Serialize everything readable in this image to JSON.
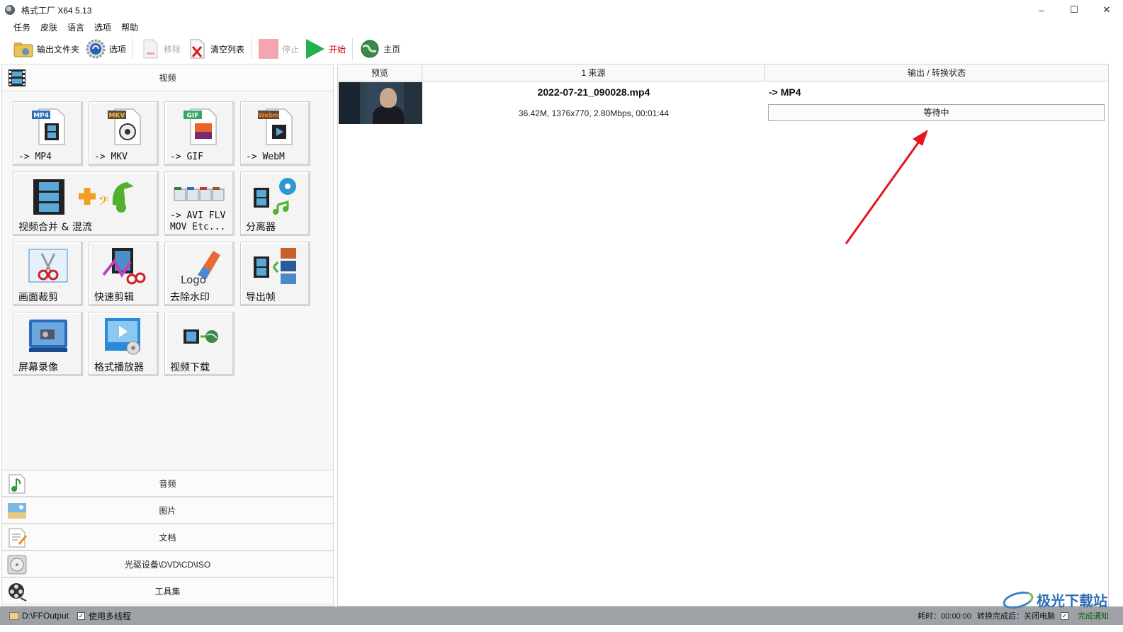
{
  "window": {
    "title": "格式工厂 X64 5.13",
    "controls": {
      "minimize": "–",
      "maximize": "☐",
      "close": "✕"
    }
  },
  "menu": [
    "任务",
    "皮肤",
    "语言",
    "选项",
    "帮助"
  ],
  "toolbar": {
    "output_folder": "输出文件夹",
    "options": "选项",
    "remove": "移除",
    "clear_list": "清空列表",
    "stop": "停止",
    "start": "开始",
    "home": "主页"
  },
  "left_panel": {
    "video_category": "视频",
    "tiles": [
      {
        "label": "-> MP4",
        "badge": "MP4"
      },
      {
        "label": "-> MKV",
        "badge": "MKV"
      },
      {
        "label": "-> GIF",
        "badge": "GIF"
      },
      {
        "label": "-> WebM",
        "badge": "Webm"
      },
      {
        "label": "视频合并 & 混流"
      },
      {
        "label": "-> AVI FLV\nMOV Etc..."
      },
      {
        "label": "分离器"
      },
      {
        "label": "画面裁剪"
      },
      {
        "label": "快速剪辑"
      },
      {
        "label": "去除水印",
        "badge": "Logo"
      },
      {
        "label": "导出帧"
      },
      {
        "label": "屏幕录像"
      },
      {
        "label": "格式播放器"
      },
      {
        "label": "视频下载"
      }
    ],
    "bottom_categories": [
      "音频",
      "图片",
      "文档",
      "光驱设备\\DVD\\CD\\ISO",
      "工具集"
    ]
  },
  "task_table": {
    "headers": [
      "预览",
      "1 来源",
      "输出 / 转换状态"
    ],
    "rows": [
      {
        "source_name": "2022-07-21_090028.mp4",
        "source_meta": "36.42M, 1376x770, 2.80Mbps, 00:01:44",
        "output_format": "-> MP4",
        "status": "等待中"
      }
    ]
  },
  "statusbar": {
    "output_path": "D:\\FFOutput",
    "multithread": "使用多线程",
    "elapsed": "耗时：00:00:00",
    "after_convert": "转换完成后：关闭电脑",
    "notify": "完成通知"
  },
  "watermark": "极光下载站",
  "colors": {
    "start_green": "#22b14c",
    "stop_pink": "#f4a6b0",
    "annotation_red": "#e8141c",
    "statusbar": "#9ea2a6"
  }
}
